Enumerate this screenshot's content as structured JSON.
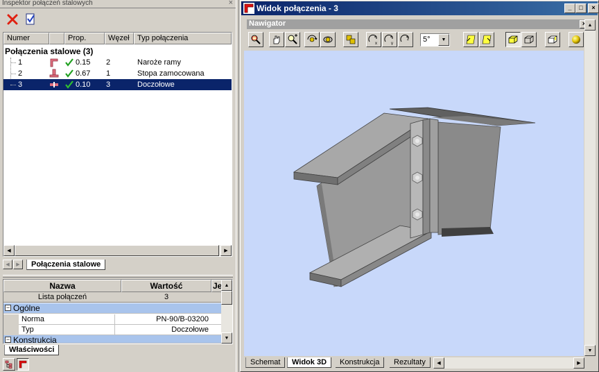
{
  "inspector": {
    "title": "Inspektor połączeń stalowych",
    "columns": [
      "Numer",
      "Prop.",
      "Węzeł",
      "Typ połączenia"
    ],
    "group_label": "Połączenia stalowe (3)",
    "rows": [
      {
        "num": "1",
        "prop": "0.15",
        "node": "2",
        "type": "Naroże ramy"
      },
      {
        "num": "2",
        "prop": "0.67",
        "node": "1",
        "type": "Stopa zamocowana"
      },
      {
        "num": "3",
        "prop": "0.10",
        "node": "3",
        "type": "Doczołowe"
      }
    ],
    "tab_label": "Połączenia stalowe"
  },
  "properties": {
    "col_name": "Nazwa",
    "col_value": "Wartość",
    "col_unit": "Je",
    "list_label": "Lista połączeń",
    "list_value": "3",
    "section_general": "Ogólne",
    "norm_label": "Norma",
    "norm_value": "PN-90/B-03200",
    "type_label": "Typ",
    "type_value": "Doczołowe",
    "section_construction": "Konstrukcja",
    "tab_label": "Właściwości"
  },
  "view": {
    "title": "Widok połączenia - 3",
    "navigator_title": "Nawigator",
    "angle_value": "5°",
    "tabs": [
      "Schemat",
      "Widok 3D",
      "Konstrukcja",
      "Rezultaty"
    ],
    "active_tab": "Widok 3D"
  },
  "colors": {
    "selection": "#0a246a",
    "title_active": "#0a246a",
    "title_inactive": "#808080",
    "viewport_bg": "#c8d8fa",
    "ok_green": "#20a020"
  }
}
